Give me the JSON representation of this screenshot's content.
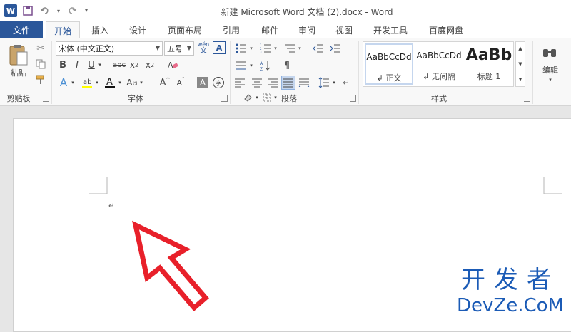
{
  "window": {
    "title": "新建 Microsoft Word 文档 (2).docx - Word"
  },
  "qat": {
    "logo": "W"
  },
  "tabs": {
    "file": "文件",
    "items": [
      "开始",
      "插入",
      "设计",
      "页面布局",
      "引用",
      "邮件",
      "审阅",
      "视图",
      "开发工具",
      "百度网盘"
    ]
  },
  "clipboard": {
    "paste": "粘贴",
    "label": "剪贴板"
  },
  "font": {
    "name": "宋体 (中文正文)",
    "size": "五号",
    "wen": "wén",
    "label": "字体"
  },
  "paragraph": {
    "label": "段落"
  },
  "styles": {
    "label": "样式",
    "items": [
      {
        "sample": "AaBbCcDd",
        "name": "↲ 正文"
      },
      {
        "sample": "AaBbCcDd",
        "name": "↲ 无间隔"
      },
      {
        "sample": "AaBb",
        "name": "标题 1"
      }
    ]
  },
  "editing": {
    "label": "编辑"
  },
  "document": {
    "paragraph_mark": "↵"
  },
  "watermark": {
    "line1": "开发者",
    "line2": "DevZe.CoM"
  },
  "colors": {
    "accent": "#2b579a",
    "arrow": "#e8202a",
    "watermark": "#1b5bb6"
  }
}
